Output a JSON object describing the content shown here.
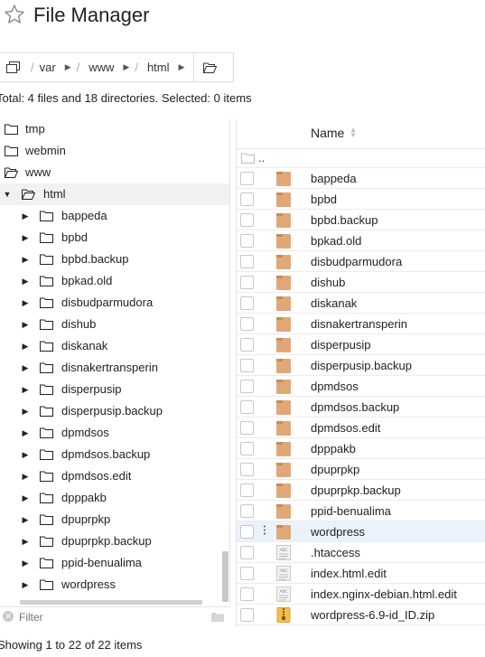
{
  "app": {
    "title": "File Manager"
  },
  "breadcrumb": {
    "items": [
      "var",
      "www",
      "html"
    ]
  },
  "summary": "Total: 4 files and 18 directories. Selected: 0 items",
  "tree": {
    "top_items": [
      {
        "label": "tmp",
        "open": false
      },
      {
        "label": "webmin",
        "open": false
      },
      {
        "label": "www",
        "open": true
      }
    ],
    "current": {
      "label": "html",
      "open": true
    },
    "children": [
      "bappeda",
      "bpbd",
      "bpbd.backup",
      "bpkad.old",
      "disbudparmudora",
      "dishub",
      "diskanak",
      "disnakertransperin",
      "disperpusip",
      "disperpusip.backup",
      "dpmdsos",
      "dpmdsos.backup",
      "dpmdsos.edit",
      "dpppakb",
      "dpuprpkp",
      "dpuprpkp.backup",
      "ppid-benualima",
      "wordpress"
    ]
  },
  "filter": {
    "placeholder": "Filter"
  },
  "list": {
    "column_name": "Name",
    "up_label": "..",
    "rows": [
      {
        "name": "bappeda",
        "type": "folder"
      },
      {
        "name": "bpbd",
        "type": "folder"
      },
      {
        "name": "bpbd.backup",
        "type": "folder"
      },
      {
        "name": "bpkad.old",
        "type": "folder"
      },
      {
        "name": "disbudparmudora",
        "type": "folder"
      },
      {
        "name": "dishub",
        "type": "folder"
      },
      {
        "name": "diskanak",
        "type": "folder"
      },
      {
        "name": "disnakertransperin",
        "type": "folder"
      },
      {
        "name": "disperpusip",
        "type": "folder"
      },
      {
        "name": "disperpusip.backup",
        "type": "folder"
      },
      {
        "name": "dpmdsos",
        "type": "folder"
      },
      {
        "name": "dpmdsos.backup",
        "type": "folder"
      },
      {
        "name": "dpmdsos.edit",
        "type": "folder"
      },
      {
        "name": "dpppakb",
        "type": "folder"
      },
      {
        "name": "dpuprpkp",
        "type": "folder"
      },
      {
        "name": "dpuprpkp.backup",
        "type": "folder"
      },
      {
        "name": "ppid-benualima",
        "type": "folder"
      },
      {
        "name": "wordpress",
        "type": "folder",
        "hover": true
      },
      {
        "name": ".htaccess",
        "type": "text"
      },
      {
        "name": "index.html.edit",
        "type": "text"
      },
      {
        "name": "index.nginx-debian.html.edit",
        "type": "text"
      },
      {
        "name": "wordpress-6.9-id_ID.zip",
        "type": "zip"
      }
    ]
  },
  "footer": "Showing 1 to 22 of 22 items",
  "colors": {
    "folder": "#e0a877",
    "folder_dark": "#c98a55",
    "zip": "#f2c04a",
    "hover": "#eaf3fc"
  }
}
